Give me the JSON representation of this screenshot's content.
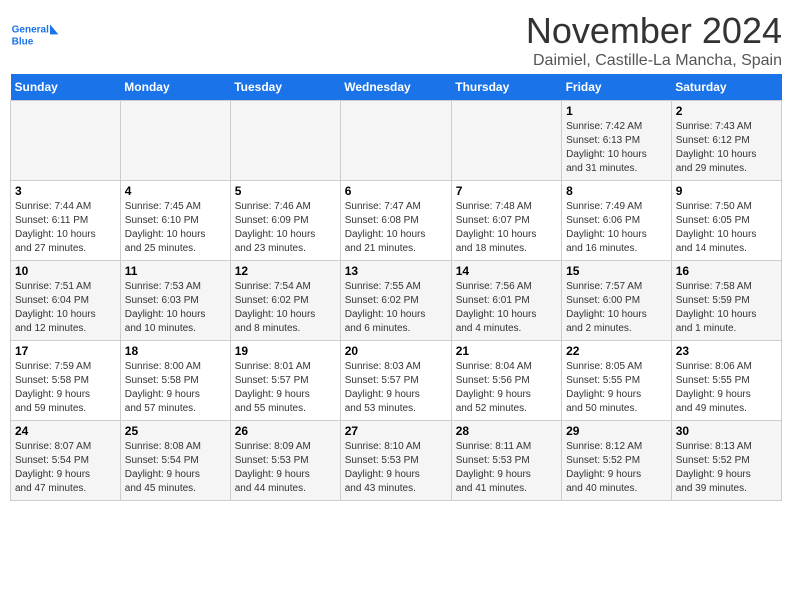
{
  "header": {
    "logo_line1": "General",
    "logo_line2": "Blue",
    "month": "November 2024",
    "location": "Daimiel, Castille-La Mancha, Spain"
  },
  "weekdays": [
    "Sunday",
    "Monday",
    "Tuesday",
    "Wednesday",
    "Thursday",
    "Friday",
    "Saturday"
  ],
  "weeks": [
    [
      {
        "day": "",
        "detail": ""
      },
      {
        "day": "",
        "detail": ""
      },
      {
        "day": "",
        "detail": ""
      },
      {
        "day": "",
        "detail": ""
      },
      {
        "day": "",
        "detail": ""
      },
      {
        "day": "1",
        "detail": "Sunrise: 7:42 AM\nSunset: 6:13 PM\nDaylight: 10 hours\nand 31 minutes."
      },
      {
        "day": "2",
        "detail": "Sunrise: 7:43 AM\nSunset: 6:12 PM\nDaylight: 10 hours\nand 29 minutes."
      }
    ],
    [
      {
        "day": "3",
        "detail": "Sunrise: 7:44 AM\nSunset: 6:11 PM\nDaylight: 10 hours\nand 27 minutes."
      },
      {
        "day": "4",
        "detail": "Sunrise: 7:45 AM\nSunset: 6:10 PM\nDaylight: 10 hours\nand 25 minutes."
      },
      {
        "day": "5",
        "detail": "Sunrise: 7:46 AM\nSunset: 6:09 PM\nDaylight: 10 hours\nand 23 minutes."
      },
      {
        "day": "6",
        "detail": "Sunrise: 7:47 AM\nSunset: 6:08 PM\nDaylight: 10 hours\nand 21 minutes."
      },
      {
        "day": "7",
        "detail": "Sunrise: 7:48 AM\nSunset: 6:07 PM\nDaylight: 10 hours\nand 18 minutes."
      },
      {
        "day": "8",
        "detail": "Sunrise: 7:49 AM\nSunset: 6:06 PM\nDaylight: 10 hours\nand 16 minutes."
      },
      {
        "day": "9",
        "detail": "Sunrise: 7:50 AM\nSunset: 6:05 PM\nDaylight: 10 hours\nand 14 minutes."
      }
    ],
    [
      {
        "day": "10",
        "detail": "Sunrise: 7:51 AM\nSunset: 6:04 PM\nDaylight: 10 hours\nand 12 minutes."
      },
      {
        "day": "11",
        "detail": "Sunrise: 7:53 AM\nSunset: 6:03 PM\nDaylight: 10 hours\nand 10 minutes."
      },
      {
        "day": "12",
        "detail": "Sunrise: 7:54 AM\nSunset: 6:02 PM\nDaylight: 10 hours\nand 8 minutes."
      },
      {
        "day": "13",
        "detail": "Sunrise: 7:55 AM\nSunset: 6:02 PM\nDaylight: 10 hours\nand 6 minutes."
      },
      {
        "day": "14",
        "detail": "Sunrise: 7:56 AM\nSunset: 6:01 PM\nDaylight: 10 hours\nand 4 minutes."
      },
      {
        "day": "15",
        "detail": "Sunrise: 7:57 AM\nSunset: 6:00 PM\nDaylight: 10 hours\nand 2 minutes."
      },
      {
        "day": "16",
        "detail": "Sunrise: 7:58 AM\nSunset: 5:59 PM\nDaylight: 10 hours\nand 1 minute."
      }
    ],
    [
      {
        "day": "17",
        "detail": "Sunrise: 7:59 AM\nSunset: 5:58 PM\nDaylight: 9 hours\nand 59 minutes."
      },
      {
        "day": "18",
        "detail": "Sunrise: 8:00 AM\nSunset: 5:58 PM\nDaylight: 9 hours\nand 57 minutes."
      },
      {
        "day": "19",
        "detail": "Sunrise: 8:01 AM\nSunset: 5:57 PM\nDaylight: 9 hours\nand 55 minutes."
      },
      {
        "day": "20",
        "detail": "Sunrise: 8:03 AM\nSunset: 5:57 PM\nDaylight: 9 hours\nand 53 minutes."
      },
      {
        "day": "21",
        "detail": "Sunrise: 8:04 AM\nSunset: 5:56 PM\nDaylight: 9 hours\nand 52 minutes."
      },
      {
        "day": "22",
        "detail": "Sunrise: 8:05 AM\nSunset: 5:55 PM\nDaylight: 9 hours\nand 50 minutes."
      },
      {
        "day": "23",
        "detail": "Sunrise: 8:06 AM\nSunset: 5:55 PM\nDaylight: 9 hours\nand 49 minutes."
      }
    ],
    [
      {
        "day": "24",
        "detail": "Sunrise: 8:07 AM\nSunset: 5:54 PM\nDaylight: 9 hours\nand 47 minutes."
      },
      {
        "day": "25",
        "detail": "Sunrise: 8:08 AM\nSunset: 5:54 PM\nDaylight: 9 hours\nand 45 minutes."
      },
      {
        "day": "26",
        "detail": "Sunrise: 8:09 AM\nSunset: 5:53 PM\nDaylight: 9 hours\nand 44 minutes."
      },
      {
        "day": "27",
        "detail": "Sunrise: 8:10 AM\nSunset: 5:53 PM\nDaylight: 9 hours\nand 43 minutes."
      },
      {
        "day": "28",
        "detail": "Sunrise: 8:11 AM\nSunset: 5:53 PM\nDaylight: 9 hours\nand 41 minutes."
      },
      {
        "day": "29",
        "detail": "Sunrise: 8:12 AM\nSunset: 5:52 PM\nDaylight: 9 hours\nand 40 minutes."
      },
      {
        "day": "30",
        "detail": "Sunrise: 8:13 AM\nSunset: 5:52 PM\nDaylight: 9 hours\nand 39 minutes."
      }
    ]
  ]
}
